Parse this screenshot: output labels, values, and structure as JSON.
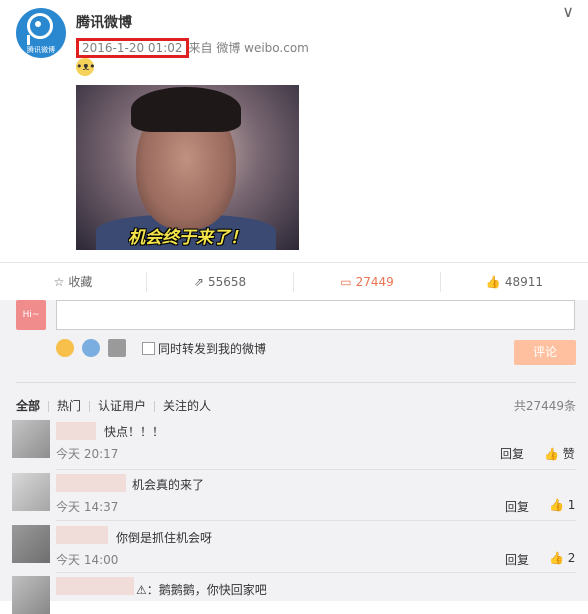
{
  "post": {
    "username": "腾讯微博",
    "avatar_caption": "腾讯微博",
    "time": "2016-1-20 01:02",
    "source": "来自 微博 weibo.com",
    "image_caption": "机会终于来了！"
  },
  "actions": {
    "favorite": "收藏",
    "repost": "55658",
    "comment": "27449",
    "like": "48911"
  },
  "comment_box": {
    "avatar_text": "Hi~",
    "repost_label": "同时转发到我的微博",
    "submit": "评论"
  },
  "filters": {
    "all": "全部",
    "hot": "热门",
    "verified": "认证用户",
    "following": "关注的人",
    "total": "共27449条"
  },
  "comments": [
    {
      "text": "快点！！！",
      "time": "今天 20:17",
      "reply": "回复",
      "like": "赞"
    },
    {
      "text": "机会真的来了",
      "time": "今天 14:37",
      "reply": "回复",
      "like": "1"
    },
    {
      "text": "你倒是抓住机会呀",
      "time": "今天 14:00",
      "reply": "回复",
      "like": "2"
    },
    {
      "text": "：鹅鹅鹅，你快回家吧"
    }
  ]
}
